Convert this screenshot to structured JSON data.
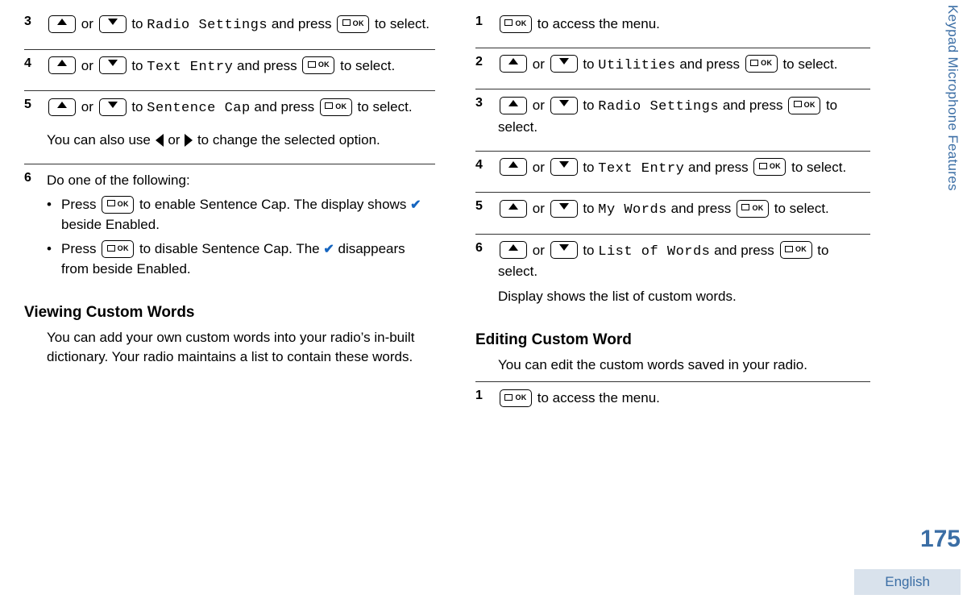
{
  "sidetab": "Keypad Microphone Features",
  "pagenum": "175",
  "language": "English",
  "labels": {
    "or": "or",
    "to": "to",
    "and_press": "and press",
    "to_select": "to select.",
    "to_access_menu": "to access the menu.",
    "press": "Press",
    "ok": "OK"
  },
  "left": {
    "step3": {
      "num": "3",
      "target": "Radio Settings"
    },
    "step4": {
      "num": "4",
      "target": "Text Entry"
    },
    "step5": {
      "num": "5",
      "target": "Sentence Cap",
      "note_a": "You can also use",
      "note_b": "to change the selected option."
    },
    "step6": {
      "num": "6",
      "intro": "Do one of the following:",
      "b1a": "to enable Sentence Cap. The display shows",
      "b1b": "beside Enabled.",
      "b2a": "to disable Sentence Cap. The",
      "b2b": "disappears from beside Enabled."
    },
    "heading": "Viewing Custom Words",
    "para": "You can add your own custom words into your radio’s in-built dictionary. Your radio maintains a list to contain these words."
  },
  "right": {
    "step1": {
      "num": "1"
    },
    "step2": {
      "num": "2",
      "target": "Utilities"
    },
    "step3": {
      "num": "3",
      "target": "Radio Settings"
    },
    "step4": {
      "num": "4",
      "target": "Text Entry"
    },
    "step5": {
      "num": "5",
      "target": "My Words"
    },
    "step6": {
      "num": "6",
      "target": "List of Words",
      "tail": "Display shows the list of custom words."
    },
    "heading": "Editing Custom Word",
    "para": "You can edit the custom words saved in your radio.",
    "stepB1": {
      "num": "1"
    }
  }
}
